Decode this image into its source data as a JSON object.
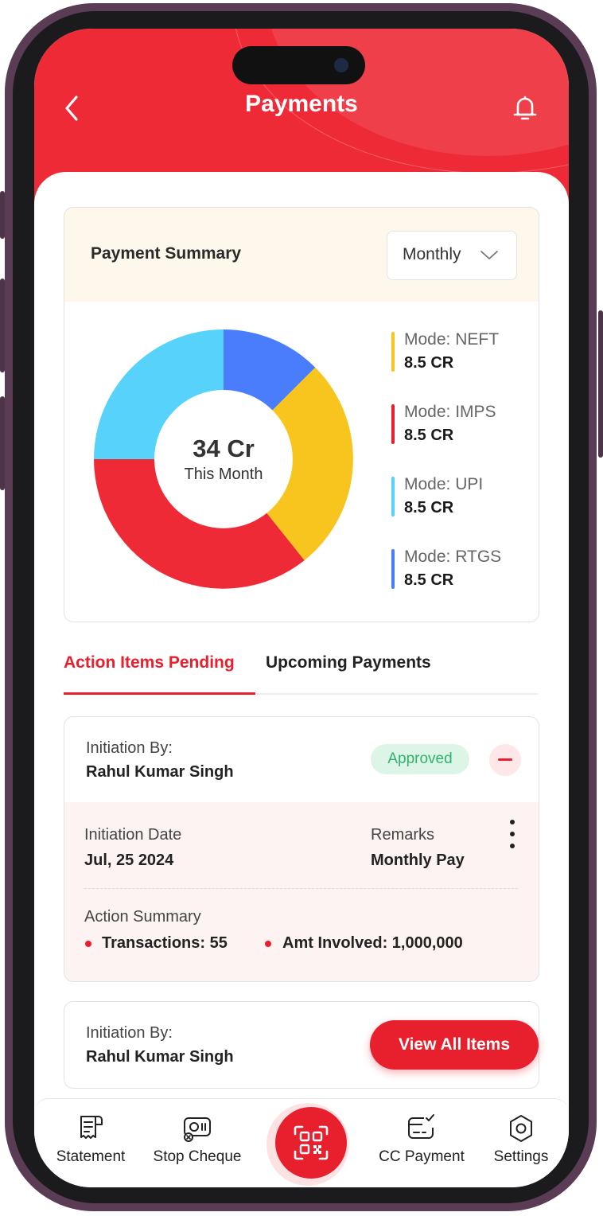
{
  "header": {
    "title": "Payments"
  },
  "summary": {
    "title": "Payment Summary",
    "period": "Monthly",
    "total_value": "34 Cr",
    "total_caption": "This Month",
    "legend": [
      {
        "label": "Mode: NEFT",
        "value": "8.5 CR",
        "color": "#f7c51e"
      },
      {
        "label": "Mode: IMPS",
        "value": "8.5 CR",
        "color": "#e8202e"
      },
      {
        "label": "Mode: UPI",
        "value": "8.5 CR",
        "color": "#57d2fb"
      },
      {
        "label": "Mode: RTGS",
        "value": "8.5 CR",
        "color": "#4a7dfb"
      }
    ]
  },
  "tabs": {
    "active": "Action Items Pending",
    "other": "Upcoming Payments"
  },
  "items": [
    {
      "initiation_label": "Initiation By:",
      "initiator": "Rahul Kumar Singh",
      "status": "Approved",
      "date_label": "Initiation Date",
      "date": "Jul, 25 2024",
      "remarks_label": "Remarks",
      "remarks": "Monthly Pay",
      "summary_label": "Action Summary",
      "transactions": "Transactions: 55",
      "amount": "Amt Involved: 1,000,000"
    },
    {
      "initiation_label": "Initiation By:",
      "initiator": "Rahul Kumar Singh"
    }
  ],
  "view_all_label": "View All Items",
  "nav": {
    "statement": "Statement",
    "stop_cheque": "Stop Cheque",
    "cc_payment": "CC Payment",
    "settings": "Settings"
  },
  "colors": {
    "brand": "#e8202e",
    "approved_bg": "#ddf5e7",
    "approved_text": "#2fb36c"
  },
  "icons": [
    "back-arrow-icon",
    "bell-icon",
    "chevron-down-icon",
    "kebab-menu-icon",
    "receipt-icon",
    "cheque-icon",
    "qr-scan-icon",
    "card-check-icon",
    "settings-hexagon-icon"
  ]
}
